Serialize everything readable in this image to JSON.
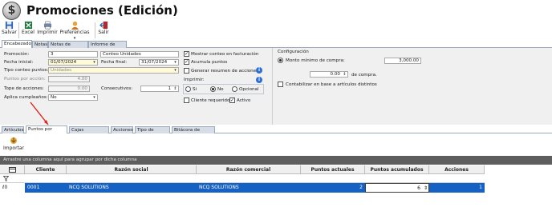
{
  "title": "Promociones (Edición)",
  "toolbar": {
    "save": "Salvar",
    "excel": "Excel",
    "print": "Imprimir",
    "prefs": "Preferencias",
    "exit": "Salir"
  },
  "tabs_top": [
    "Encabezado",
    "Notas",
    "Notas de impresión",
    "Informe de ventas"
  ],
  "form": {
    "promocion_label": "Promoción:",
    "promocion_value": "3",
    "nombre_value": "Conteo Unidades",
    "fecha_inicial_label": "Fecha inicial:",
    "fecha_inicial_value": "01/07/2024",
    "fecha_final_label": "Fecha final:",
    "fecha_final_value": "31/07/2024",
    "tipo_conteo_label": "Tipo conteo puntos:",
    "tipo_conteo_value": "Unidades",
    "puntos_accion_label": "Puntos por acción:",
    "puntos_accion_value": "4.00",
    "tope_label": "Tope de acciones:",
    "tope_value": "0.00",
    "consecutivos_label": "Consecutivos:",
    "consecutivos_value": "1",
    "aplica_cumple_label": "Aplica cumpleaños:",
    "aplica_cumple_value": "No",
    "mostrar_conteo": "Mostrar conteo en facturación",
    "acumula_puntos": "Acumula puntos",
    "generar_resumen": "Generar resumen de acciones",
    "imprimir_label": "Imprimir:",
    "radio_si": "Si",
    "radio_no": "No",
    "radio_opcional": "Opcional",
    "cliente_requerido": "Cliente requerido",
    "activo": "Activo",
    "configuracion_label": "Configuración",
    "monto_minimo_label": "Monto mínimo de compra:",
    "monto_minimo_value": "3,000.00",
    "de_compra_value": "0.00",
    "de_compra_label": "de compra.",
    "contabilizar": "Contabilizar en base a artículos distintos"
  },
  "tabs_bottom": [
    "Artículos",
    "Puntos por cliente",
    "Cajas asignadas",
    "Acciones",
    "Tipo de cliente",
    "Bitácora de puntos"
  ],
  "import_label": "Importar",
  "groupbar_text": "Arrastre una columna aquí para agrupar por dicha columna",
  "grid": {
    "columns": [
      "Cliente",
      "Razón social",
      "Razón comercial",
      "Puntos actuales",
      "Puntos acumulados",
      "Acciones"
    ],
    "row": {
      "cliente": "0001",
      "razon_social": "NCQ SOLUTIONS",
      "razon_comercial": "NCQ SOLUTIONS",
      "puntos_actuales": "2",
      "puntos_acumulados": "6",
      "acciones": "1"
    }
  }
}
